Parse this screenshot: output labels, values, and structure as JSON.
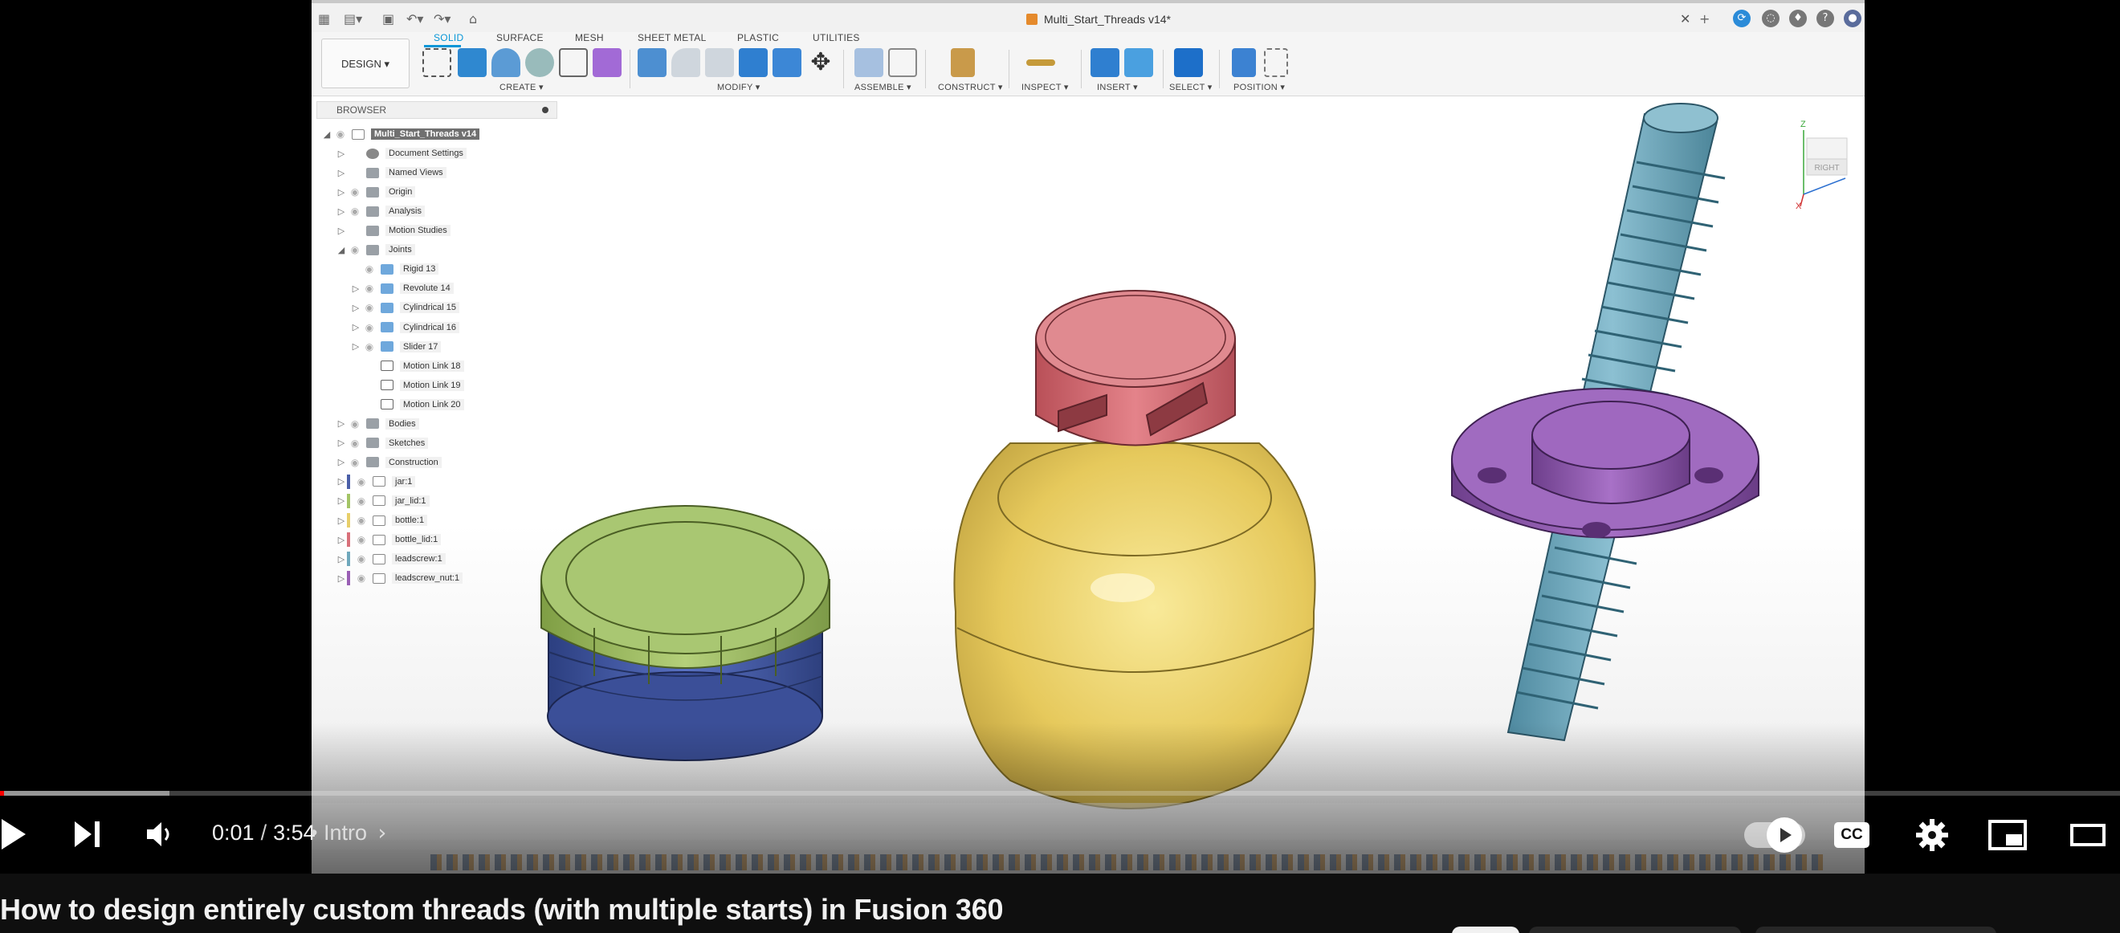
{
  "fusion": {
    "doc_tab": "Multi_Start_Threads v14*",
    "workspace_tabs": [
      "SOLID",
      "SURFACE",
      "MESH",
      "SHEET METAL",
      "PLASTIC",
      "UTILITIES"
    ],
    "design_button": "DESIGN ▾",
    "tool_groups": [
      "CREATE ▾",
      "MODIFY ▾",
      "ASSEMBLE ▾",
      "CONSTRUCT ▾",
      "INSPECT ▾",
      "INSERT ▾",
      "SELECT ▾",
      "POSITION ▾"
    ],
    "browser_title": "BROWSER",
    "tree": [
      {
        "label": "Multi_Start_Threads v14",
        "icon": "component-icon",
        "root": true
      },
      {
        "label": "Document Settings",
        "icon": "gear-icon"
      },
      {
        "label": "Named Views",
        "icon": "folder-icon"
      },
      {
        "label": "Origin",
        "icon": "folder-icon"
      },
      {
        "label": "Analysis",
        "icon": "folder-icon"
      },
      {
        "label": "Motion Studies",
        "icon": "folder-icon"
      },
      {
        "label": "Joints",
        "icon": "folder-icon",
        "expanded": true
      },
      {
        "label": "Rigid 13",
        "icon": "joint-icon"
      },
      {
        "label": "Revolute 14",
        "icon": "joint-icon"
      },
      {
        "label": "Cylindrical 15",
        "icon": "joint-icon"
      },
      {
        "label": "Cylindrical 16",
        "icon": "joint-icon"
      },
      {
        "label": "Slider 17",
        "icon": "joint-icon"
      },
      {
        "label": "Motion Link 18",
        "icon": "link-icon"
      },
      {
        "label": "Motion Link 19",
        "icon": "link-icon"
      },
      {
        "label": "Motion Link 20",
        "icon": "link-icon"
      },
      {
        "label": "Bodies",
        "icon": "folder-icon"
      },
      {
        "label": "Sketches",
        "icon": "folder-icon"
      },
      {
        "label": "Construction",
        "icon": "folder-icon"
      },
      {
        "label": "jar:1",
        "icon": "component-icon"
      },
      {
        "label": "jar_lid:1",
        "icon": "component-icon"
      },
      {
        "label": "bottle:1",
        "icon": "component-icon"
      },
      {
        "label": "bottle_lid:1",
        "icon": "component-icon"
      },
      {
        "label": "leadscrew:1",
        "icon": "component-icon"
      },
      {
        "label": "leadscrew_nut:1",
        "icon": "component-icon"
      }
    ],
    "viewcube": {
      "face": "RIGHT",
      "axis_z": "Z",
      "axis_x": "X"
    },
    "colors": {
      "accent": "#0696d7",
      "jar": "#4a5fa8",
      "jar_lid": "#a3c466",
      "bottle": "#e8cf6a",
      "bottle_lid": "#d9707a",
      "leadscrew": "#6fa8bc",
      "nut": "#9a5fb5"
    }
  },
  "player": {
    "current_time": "0:01",
    "duration": "3:54",
    "chapter": "• Intro",
    "progress_played": 0.002,
    "progress_buffered": 0.08,
    "cc_label": "CC",
    "autoplay": true
  },
  "video_title": "How to design entirely custom threads (with multiple starts) in Fusion 360"
}
